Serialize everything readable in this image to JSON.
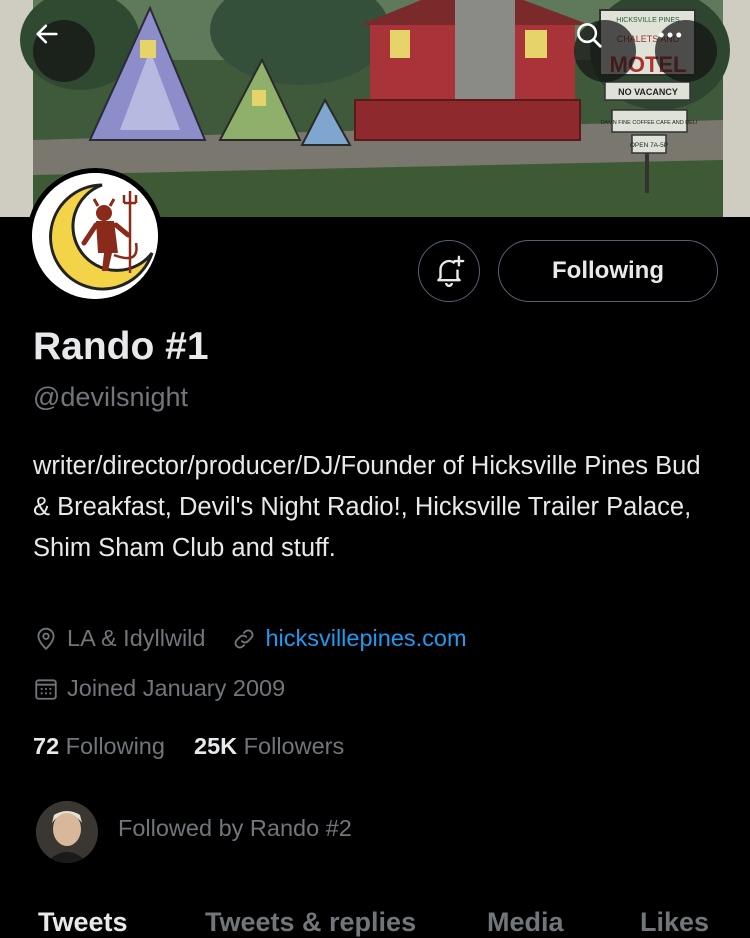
{
  "header": {
    "back_icon": "arrow-left-icon",
    "search_icon": "search-icon",
    "more_icon": "more-horizontal-icon"
  },
  "banner": {
    "sign_top": "HICKSVILLE PINES",
    "sign_chalets": "CHALETS AND",
    "sign_motel": "MOTEL",
    "sign_vacancy": "NO VACANCY",
    "sign_coffee": "DAMN FINE COFFEE CAFE AND DELI",
    "sign_open": "OPEN 7A-5P"
  },
  "profile": {
    "name": "Rando #1",
    "handle": "@devilsnight",
    "bio": "writer/director/producer/DJ/Founder of Hicksville Pines Bud & Breakfast, Devil's Night Radio!, Hicksville Trailer Palace, Shim Sham Club and stuff.",
    "location": "LA & Idyllwild",
    "website": "hicksvillepines.com",
    "joined": "Joined January 2009",
    "following_count": "72",
    "following_label": "Following",
    "followers_count": "25K",
    "followers_label": "Followers",
    "followed_by": "Followed by Rando #2"
  },
  "actions": {
    "notify_icon": "bell-plus-icon",
    "follow_label": "Following"
  },
  "tabs": [
    {
      "label": "Tweets",
      "active": true
    },
    {
      "label": "Tweets & replies",
      "active": false
    },
    {
      "label": "Media",
      "active": false
    },
    {
      "label": "Likes",
      "active": false
    }
  ],
  "colors": {
    "background": "#000000",
    "text_primary": "#e7e9ea",
    "text_secondary": "#71767b",
    "link": "#1d9bf0",
    "border": "#536471"
  }
}
